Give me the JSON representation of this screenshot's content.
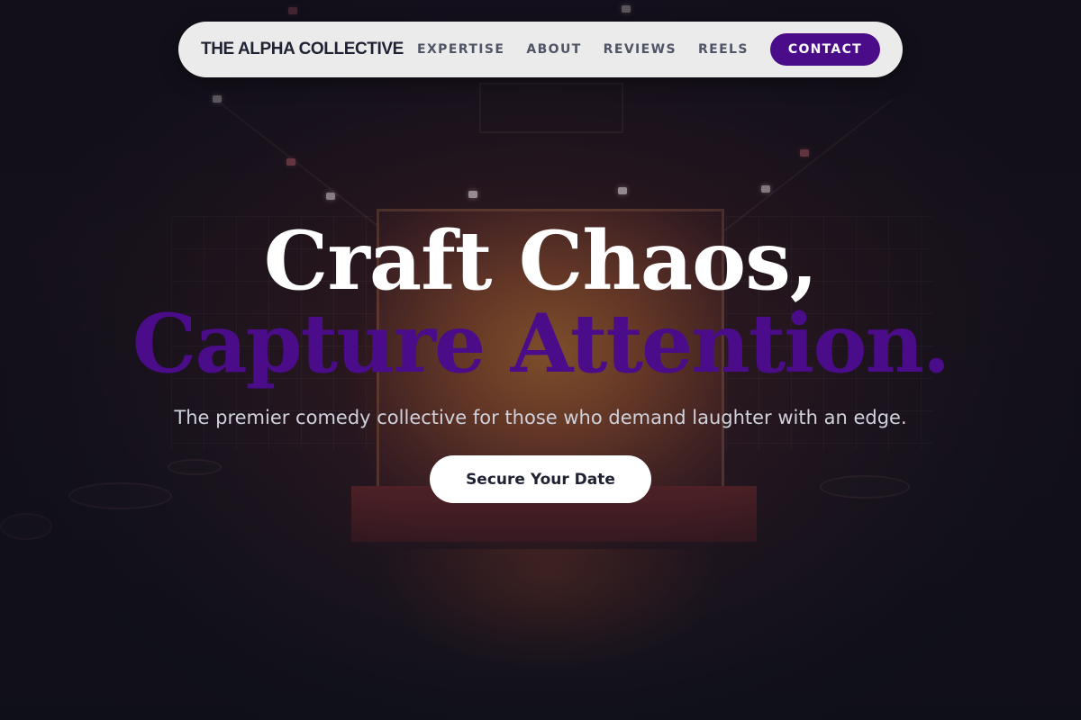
{
  "navbar": {
    "brand": "THE ALPHA COLLECTIVE",
    "links": [
      {
        "label": "EXPERTISE"
      },
      {
        "label": "ABOUT"
      },
      {
        "label": "REVIEWS"
      },
      {
        "label": "REELS"
      }
    ],
    "cta_label": "CONTACT"
  },
  "hero": {
    "headline_line1": "Craft Chaos,",
    "headline_line2": "Capture Attention.",
    "subheadline": "The premier comedy collective for those who demand laughter with an edge.",
    "cta_label": "Secure Your Date"
  },
  "colors": {
    "accent": "#4b0c8a",
    "navbar_bg": "#ebebeb",
    "text_dark": "#1f2233",
    "background": "#15141f"
  }
}
